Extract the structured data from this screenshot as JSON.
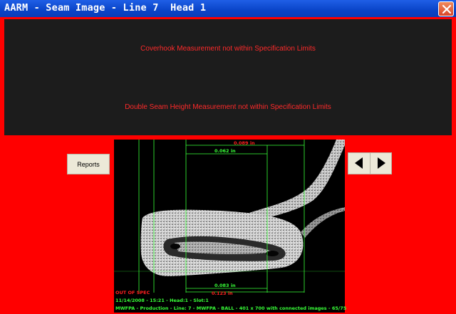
{
  "window": {
    "title": "AARM - Seam Image - Line 7  Head 1",
    "close_icon": "close-icon"
  },
  "messages": [
    "Coverhook Measurement not within Specification Limits",
    "Double Seam Height Measurement not within Specification Limits"
  ],
  "buttons": {
    "reports_label": "Reports",
    "prev_icon": "triangle-left-icon",
    "next_icon": "triangle-right-icon"
  },
  "image": {
    "measurements": {
      "top_outer": "0.089 in",
      "top_inner": "0.062 in",
      "bottom_inner": "0.083 in",
      "bottom_outer": "0.123 in"
    },
    "status": "OUT OF SPEC",
    "timestamp_line": "11/14/2008 - 15:21 - Head:1 - Slot:1",
    "info_line": "MWFPA - Production - Line: 7 - MWFPA - BALL - 401 x 700 with connected images - 65/75"
  },
  "colors": {
    "background": "#ff0000",
    "panel": "#1c1c1c",
    "message_text": "#ff2a2a",
    "measure_green": "#38ff38",
    "measure_red": "#ff2020",
    "titlebar": "#0a44c8"
  }
}
